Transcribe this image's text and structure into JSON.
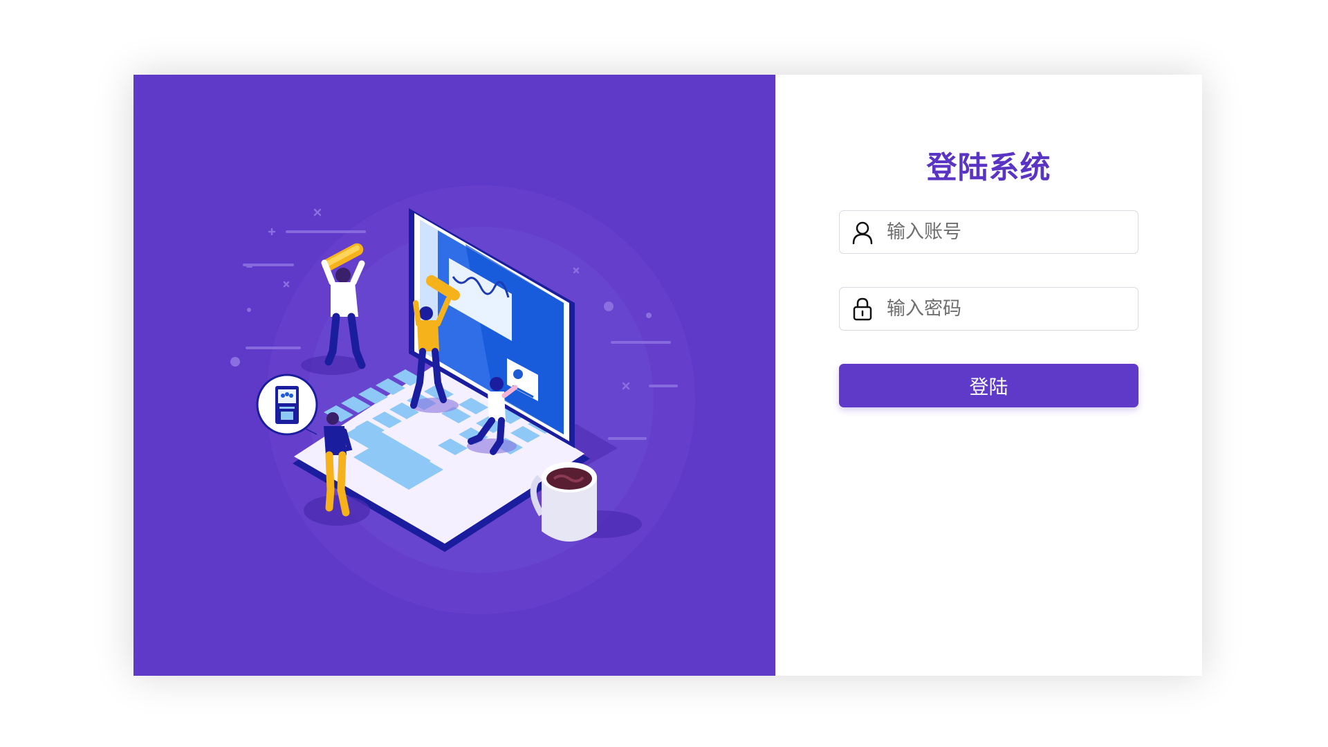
{
  "theme": {
    "accent": "#5f39c7",
    "title_color": "#5a34c3"
  },
  "illustration": {
    "icon": "laptop-team-illustration"
  },
  "form": {
    "title": "登陆系统",
    "account": {
      "placeholder": "输入账号",
      "value": "",
      "icon": "user-icon"
    },
    "password": {
      "placeholder": "输入密码",
      "value": "",
      "icon": "lock-icon"
    },
    "submit_label": "登陆"
  }
}
